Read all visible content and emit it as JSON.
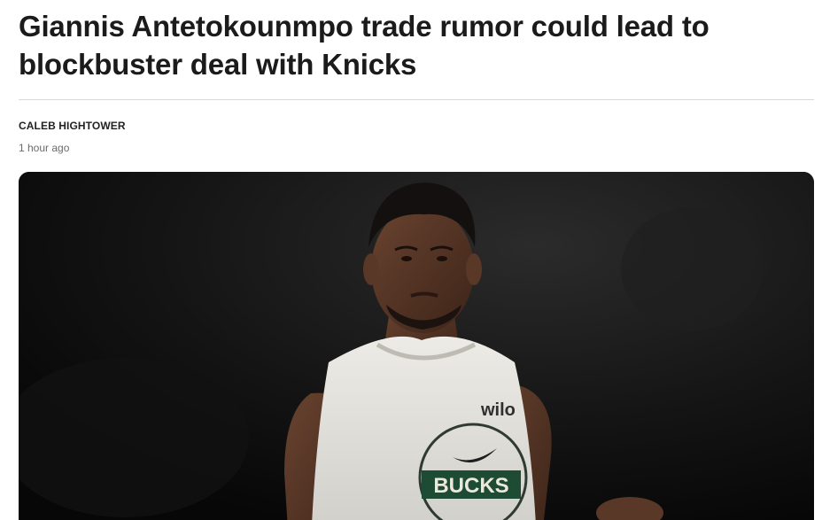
{
  "article": {
    "headline": "Giannis Antetokounmpo trade rumor could lead to blockbuster deal with Knicks",
    "author": "CALEB HIGHTOWER",
    "timestamp": "1 hour ago"
  },
  "hero_image": {
    "jersey_sponsor": "wilo",
    "jersey_wordmark": "BUCKS"
  }
}
